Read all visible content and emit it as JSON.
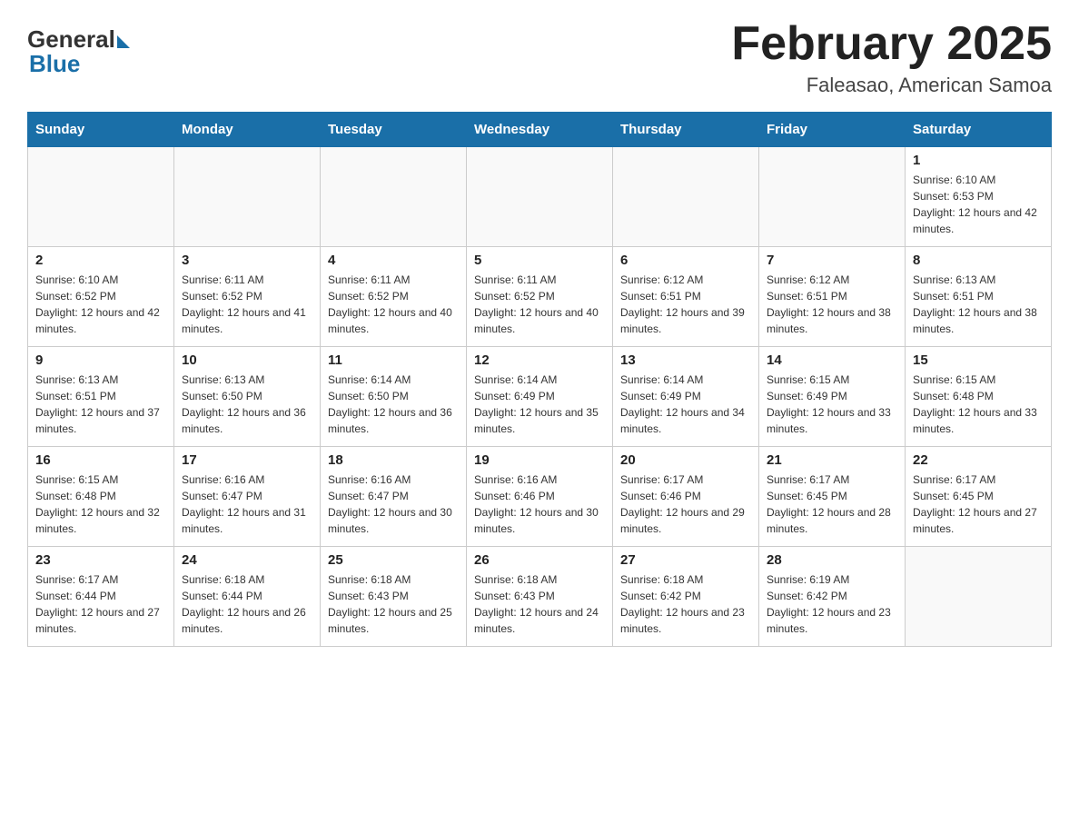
{
  "header": {
    "title": "February 2025",
    "subtitle": "Faleasao, American Samoa",
    "logo_general": "General",
    "logo_blue": "Blue"
  },
  "days_of_week": [
    "Sunday",
    "Monday",
    "Tuesday",
    "Wednesday",
    "Thursday",
    "Friday",
    "Saturday"
  ],
  "weeks": [
    {
      "days": [
        {
          "num": "",
          "info": ""
        },
        {
          "num": "",
          "info": ""
        },
        {
          "num": "",
          "info": ""
        },
        {
          "num": "",
          "info": ""
        },
        {
          "num": "",
          "info": ""
        },
        {
          "num": "",
          "info": ""
        },
        {
          "num": "1",
          "info": "Sunrise: 6:10 AM\nSunset: 6:53 PM\nDaylight: 12 hours and 42 minutes."
        }
      ]
    },
    {
      "days": [
        {
          "num": "2",
          "info": "Sunrise: 6:10 AM\nSunset: 6:52 PM\nDaylight: 12 hours and 42 minutes."
        },
        {
          "num": "3",
          "info": "Sunrise: 6:11 AM\nSunset: 6:52 PM\nDaylight: 12 hours and 41 minutes."
        },
        {
          "num": "4",
          "info": "Sunrise: 6:11 AM\nSunset: 6:52 PM\nDaylight: 12 hours and 40 minutes."
        },
        {
          "num": "5",
          "info": "Sunrise: 6:11 AM\nSunset: 6:52 PM\nDaylight: 12 hours and 40 minutes."
        },
        {
          "num": "6",
          "info": "Sunrise: 6:12 AM\nSunset: 6:51 PM\nDaylight: 12 hours and 39 minutes."
        },
        {
          "num": "7",
          "info": "Sunrise: 6:12 AM\nSunset: 6:51 PM\nDaylight: 12 hours and 38 minutes."
        },
        {
          "num": "8",
          "info": "Sunrise: 6:13 AM\nSunset: 6:51 PM\nDaylight: 12 hours and 38 minutes."
        }
      ]
    },
    {
      "days": [
        {
          "num": "9",
          "info": "Sunrise: 6:13 AM\nSunset: 6:51 PM\nDaylight: 12 hours and 37 minutes."
        },
        {
          "num": "10",
          "info": "Sunrise: 6:13 AM\nSunset: 6:50 PM\nDaylight: 12 hours and 36 minutes."
        },
        {
          "num": "11",
          "info": "Sunrise: 6:14 AM\nSunset: 6:50 PM\nDaylight: 12 hours and 36 minutes."
        },
        {
          "num": "12",
          "info": "Sunrise: 6:14 AM\nSunset: 6:49 PM\nDaylight: 12 hours and 35 minutes."
        },
        {
          "num": "13",
          "info": "Sunrise: 6:14 AM\nSunset: 6:49 PM\nDaylight: 12 hours and 34 minutes."
        },
        {
          "num": "14",
          "info": "Sunrise: 6:15 AM\nSunset: 6:49 PM\nDaylight: 12 hours and 33 minutes."
        },
        {
          "num": "15",
          "info": "Sunrise: 6:15 AM\nSunset: 6:48 PM\nDaylight: 12 hours and 33 minutes."
        }
      ]
    },
    {
      "days": [
        {
          "num": "16",
          "info": "Sunrise: 6:15 AM\nSunset: 6:48 PM\nDaylight: 12 hours and 32 minutes."
        },
        {
          "num": "17",
          "info": "Sunrise: 6:16 AM\nSunset: 6:47 PM\nDaylight: 12 hours and 31 minutes."
        },
        {
          "num": "18",
          "info": "Sunrise: 6:16 AM\nSunset: 6:47 PM\nDaylight: 12 hours and 30 minutes."
        },
        {
          "num": "19",
          "info": "Sunrise: 6:16 AM\nSunset: 6:46 PM\nDaylight: 12 hours and 30 minutes."
        },
        {
          "num": "20",
          "info": "Sunrise: 6:17 AM\nSunset: 6:46 PM\nDaylight: 12 hours and 29 minutes."
        },
        {
          "num": "21",
          "info": "Sunrise: 6:17 AM\nSunset: 6:45 PM\nDaylight: 12 hours and 28 minutes."
        },
        {
          "num": "22",
          "info": "Sunrise: 6:17 AM\nSunset: 6:45 PM\nDaylight: 12 hours and 27 minutes."
        }
      ]
    },
    {
      "days": [
        {
          "num": "23",
          "info": "Sunrise: 6:17 AM\nSunset: 6:44 PM\nDaylight: 12 hours and 27 minutes."
        },
        {
          "num": "24",
          "info": "Sunrise: 6:18 AM\nSunset: 6:44 PM\nDaylight: 12 hours and 26 minutes."
        },
        {
          "num": "25",
          "info": "Sunrise: 6:18 AM\nSunset: 6:43 PM\nDaylight: 12 hours and 25 minutes."
        },
        {
          "num": "26",
          "info": "Sunrise: 6:18 AM\nSunset: 6:43 PM\nDaylight: 12 hours and 24 minutes."
        },
        {
          "num": "27",
          "info": "Sunrise: 6:18 AM\nSunset: 6:42 PM\nDaylight: 12 hours and 23 minutes."
        },
        {
          "num": "28",
          "info": "Sunrise: 6:19 AM\nSunset: 6:42 PM\nDaylight: 12 hours and 23 minutes."
        },
        {
          "num": "",
          "info": ""
        }
      ]
    }
  ]
}
